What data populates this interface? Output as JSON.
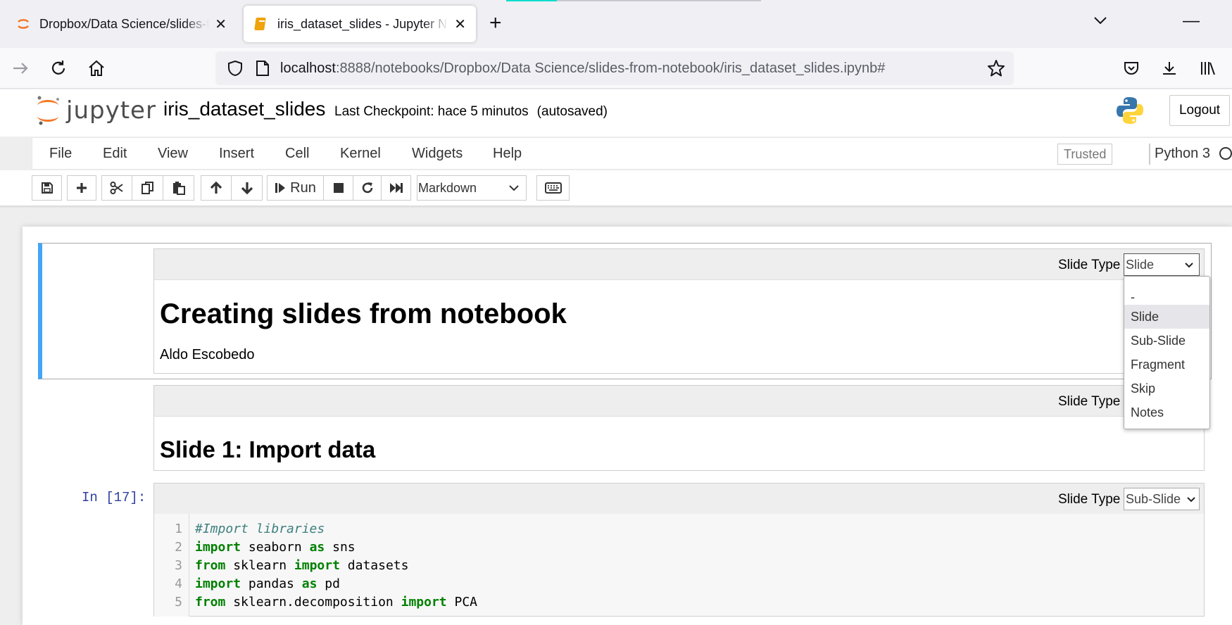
{
  "browser": {
    "tabs": [
      {
        "title": "Dropbox/Data Science/slides-from-notebook"
      },
      {
        "title": "iris_dataset_slides - Jupyter Notebook"
      }
    ],
    "url_host": "localhost",
    "url_rest": ":8888/notebooks/Dropbox/Data Science/slides-from-notebook/iris_dataset_slides.ipynb#"
  },
  "jupyter": {
    "logo_text": "jupyter",
    "notebook_name": "iris_dataset_slides",
    "checkpoint": "Last Checkpoint: hace 5 minutos",
    "autosaved": "(autosaved)",
    "logout": "Logout",
    "menu": [
      "File",
      "Edit",
      "View",
      "Insert",
      "Cell",
      "Kernel",
      "Widgets",
      "Help"
    ],
    "trusted": "Trusted",
    "kernel": "Python 3",
    "run_label": "Run",
    "cell_type": "Markdown"
  },
  "cells": {
    "slide_type_label": "Slide Type",
    "cell1": {
      "slide_type": "Slide",
      "title": "Creating slides from notebook",
      "author": "Aldo Escobedo"
    },
    "cell2": {
      "title": "Slide 1: Import data"
    },
    "cell3": {
      "prompt": "In [17]:",
      "slide_type": "Sub-Slide",
      "line_numbers": [
        "1",
        "2",
        "3",
        "4",
        "5"
      ]
    }
  },
  "slide_type_options": [
    "-",
    "Slide",
    "Sub-Slide",
    "Fragment",
    "Skip",
    "Notes"
  ],
  "colors": {
    "selected_cell_border": "#42a5f5",
    "code_keyword": "#008000",
    "code_comment": "#408080",
    "prompt": "#303f9f"
  }
}
